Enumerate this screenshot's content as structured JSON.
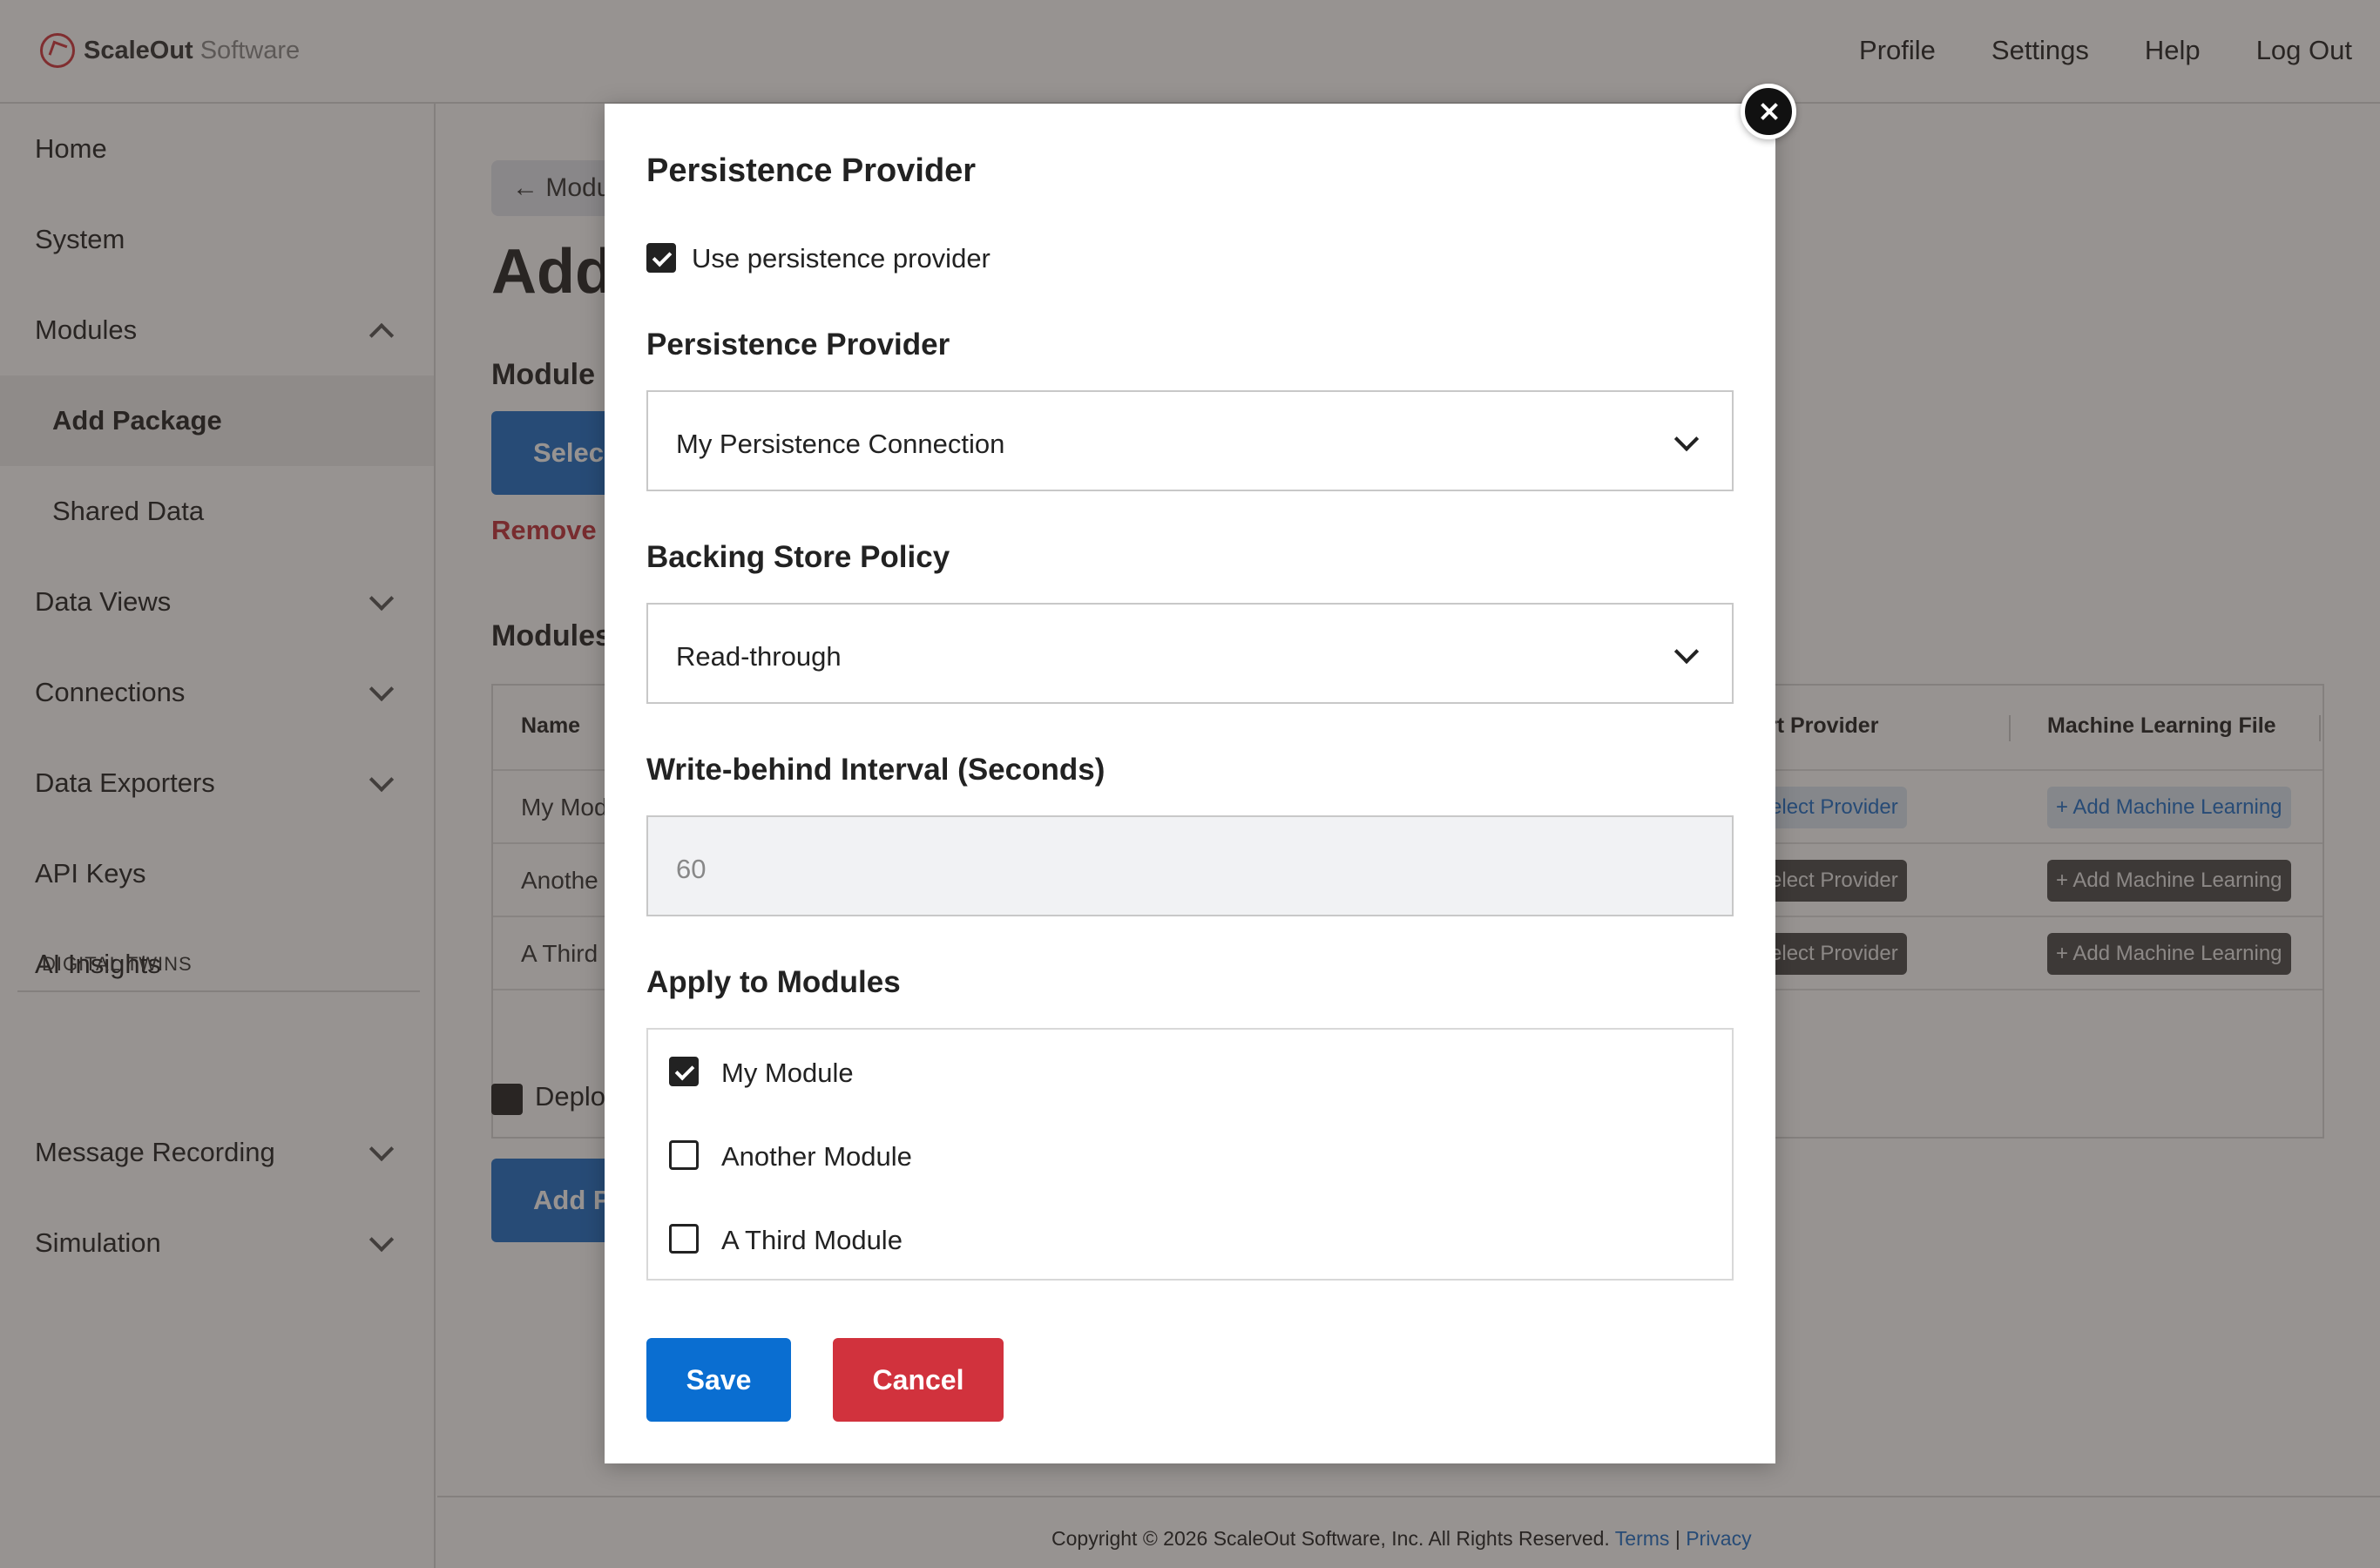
{
  "brand": {
    "name_bold": "ScaleOut",
    "name_light": "Software"
  },
  "topnav": [
    "Profile",
    "Settings",
    "Help",
    "Log Out"
  ],
  "sidebar": {
    "items": [
      {
        "label": "Home"
      },
      {
        "label": "System"
      },
      {
        "label": "Modules"
      },
      {
        "label": "Add Package"
      },
      {
        "label": "Shared Data"
      },
      {
        "label": "Data Views"
      },
      {
        "label": "Connections"
      },
      {
        "label": "Data Exporters"
      },
      {
        "label": "API Keys"
      },
      {
        "label": "AI Insights"
      },
      {
        "label": "Message Recording"
      },
      {
        "label": "Simulation"
      }
    ],
    "section_label": "DIGITAL TWINS"
  },
  "main": {
    "back_label": "Modu",
    "title": "Add",
    "module_label": "Module",
    "select_button": "Selec",
    "remove_link": "Remove I",
    "modules_heading": "Modules",
    "table": {
      "headers": [
        "Name",
        "rt Provider",
        "Machine Learning File"
      ],
      "rows": [
        {
          "name": "My Mod",
          "provider": "Select Provider",
          "ml": "+ Add Machine Learning"
        },
        {
          "name": "Anothe",
          "provider": "Select Provider",
          "ml": "+ Add Machine Learning"
        },
        {
          "name": "A Third",
          "provider": "Select Provider",
          "ml": "+ Add Machine Learning"
        }
      ]
    },
    "deploy_label": "Deplo",
    "add_button": "Add P"
  },
  "footer": {
    "copyright": "Copyright © 2026 ScaleOut Software, Inc. All Rights Reserved.",
    "terms": "Terms",
    "sep": "|",
    "privacy": "Privacy"
  },
  "modal": {
    "title": "Persistence Provider",
    "use_provider_label": "Use persistence provider",
    "provider_label": "Persistence Provider",
    "provider_value": "My Persistence Connection",
    "backing_label": "Backing Store Policy",
    "backing_value": "Read-through",
    "interval_label": "Write-behind Interval (Seconds)",
    "interval_value": "60",
    "apply_label": "Apply to Modules",
    "modules": [
      {
        "label": "My Module",
        "checked": true
      },
      {
        "label": "Another Module",
        "checked": false
      },
      {
        "label": "A Third Module",
        "checked": false
      }
    ],
    "save": "Save",
    "cancel": "Cancel"
  }
}
